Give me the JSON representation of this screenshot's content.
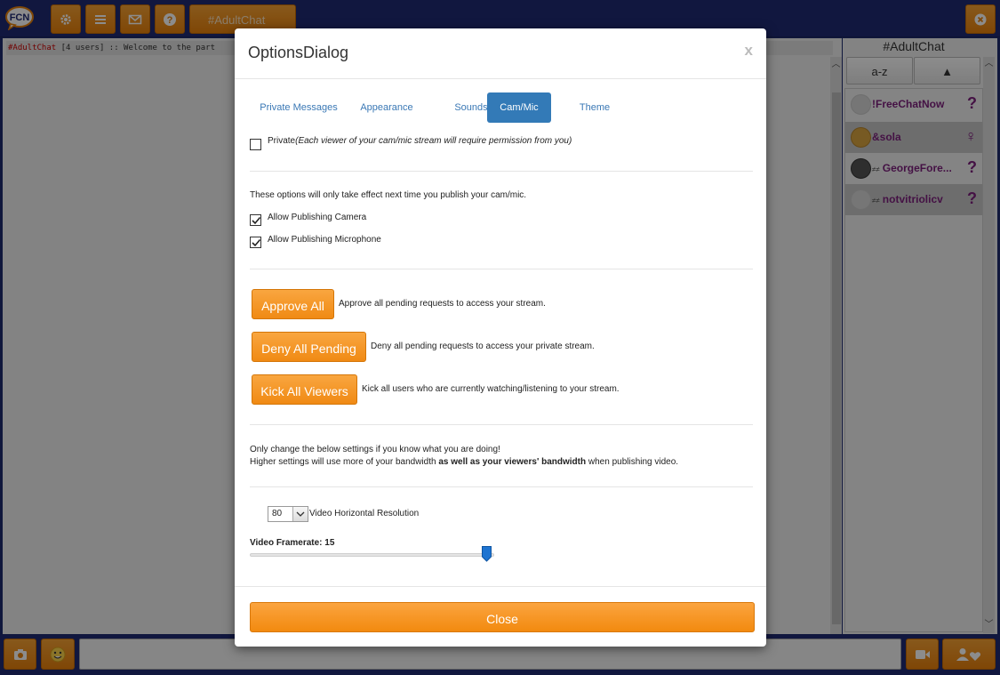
{
  "app": {
    "logo_text": "FCN",
    "channel_tab": "#AdultChat",
    "chat_line": {
      "channel": "#AdultChat",
      "rest": " [4 users] :: Welcome to the part"
    }
  },
  "user_panel": {
    "title": "#AdultChat",
    "sort_az": "a-z",
    "sort_dir": "▲",
    "users": [
      {
        "name": "!FreeChatNow",
        "status": "?",
        "tag": ""
      },
      {
        "name": "&sola",
        "status": "♀",
        "tag": ""
      },
      {
        "name": "GeorgeFore...",
        "status": "?",
        "tag": "≠≠"
      },
      {
        "name": "notvitriolicv",
        "status": "?",
        "tag": "≠≠"
      }
    ]
  },
  "dialog": {
    "title": "OptionsDialog",
    "close_x": "x",
    "tabs": [
      "Private Messages",
      "Appearance",
      "Sounds",
      "Cam/Mic",
      "Theme"
    ],
    "active_tab": "Cam/Mic",
    "private_label": "Private",
    "private_hint": "(Each viewer of your cam/mic stream will require permission from you)",
    "private_checked": false,
    "publish_note": "These options will only take effect next time you publish your cam/mic.",
    "allow_camera": "Allow Publishing Camera",
    "allow_camera_checked": true,
    "allow_mic": "Allow Publishing Microphone",
    "allow_mic_checked": true,
    "approve_all": "Approve All",
    "approve_all_desc": "Approve all pending requests to access your stream.",
    "deny_all": "Deny All Pending",
    "deny_all_desc": "Deny all pending requests to access your private stream.",
    "kick_all": "Kick All Viewers",
    "kick_all_desc": "Kick all users who are currently watching/listening to your stream.",
    "warn_line1": "Only change the below settings if you know what you are doing!",
    "warn_line2_a": "Higher settings will use more of your bandwidth ",
    "warn_line2_b": "as well as your viewers' bandwidth",
    "warn_line2_c": " when publishing video.",
    "resolution_value": "80",
    "resolution_label": "Video Horizontal Resolution",
    "framerate_label": "Video Framerate: 15",
    "framerate_fraction": 0.97,
    "close_button": "Close"
  },
  "colors": {
    "accent_orange": "#f08a14",
    "navy": "#1f2b73",
    "active_tab": "#337ab7",
    "username": "#7d1f7d"
  }
}
